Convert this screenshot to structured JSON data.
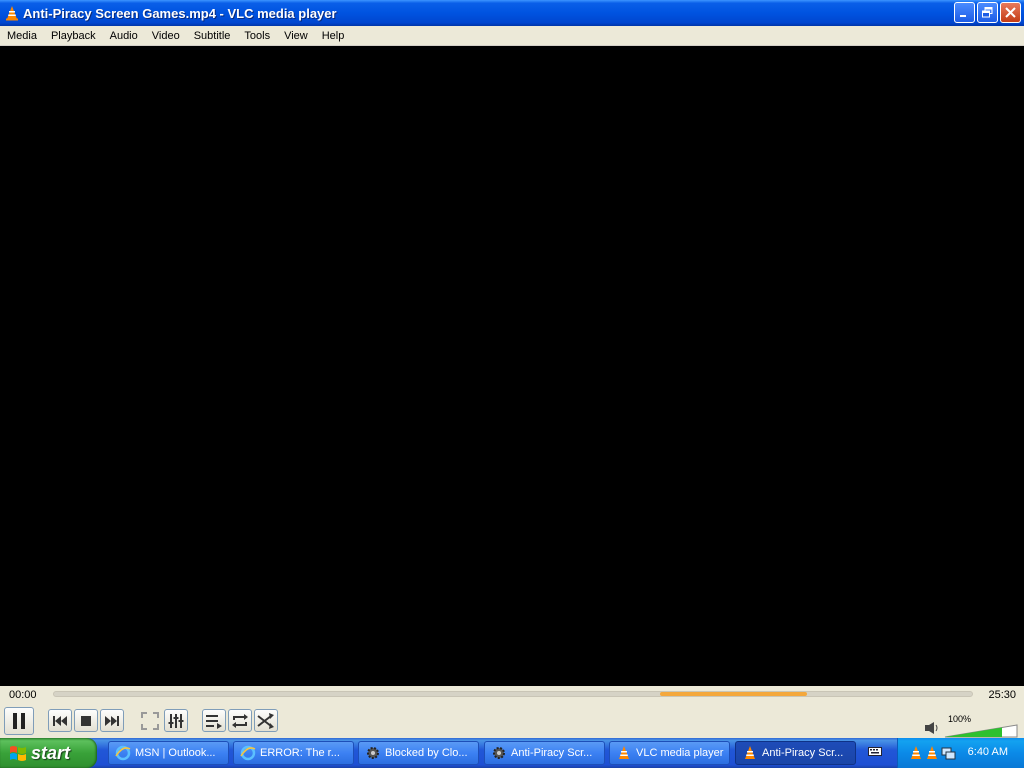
{
  "window": {
    "title": "Anti-Piracy Screen Games.mp4 - VLC media player"
  },
  "menu": [
    "Media",
    "Playback",
    "Audio",
    "Video",
    "Subtitle",
    "Tools",
    "View",
    "Help"
  ],
  "player": {
    "elapsed": "00:00",
    "total": "25:30",
    "volume_label": "100%",
    "volume_level": 1.0,
    "buffered_fraction_start": 0.66,
    "buffered_fraction_end": 0.82
  },
  "taskbar": {
    "start_label": "start",
    "tasks": [
      {
        "label": "MSN | Outlook...",
        "icon": "ie-icon",
        "active": false
      },
      {
        "label": "ERROR: The r...",
        "icon": "ie-icon",
        "active": false
      },
      {
        "label": "Blocked by Clo...",
        "icon": "gear-icon",
        "active": false
      },
      {
        "label": "Anti-Piracy Scr...",
        "icon": "gear-icon",
        "active": false
      },
      {
        "label": "VLC media player",
        "icon": "vlc-icon",
        "active": false
      },
      {
        "label": "Anti-Piracy Scr...",
        "icon": "vlc-icon",
        "active": true
      }
    ],
    "clock": "6:40 AM"
  },
  "colors": {
    "titlebar": "#0053e0",
    "chrome": "#ece9d8",
    "seek_buffer": "#f4a83c",
    "taskbar": "#2157d7",
    "start": "#39a239",
    "tray": "#0b8ae8"
  }
}
